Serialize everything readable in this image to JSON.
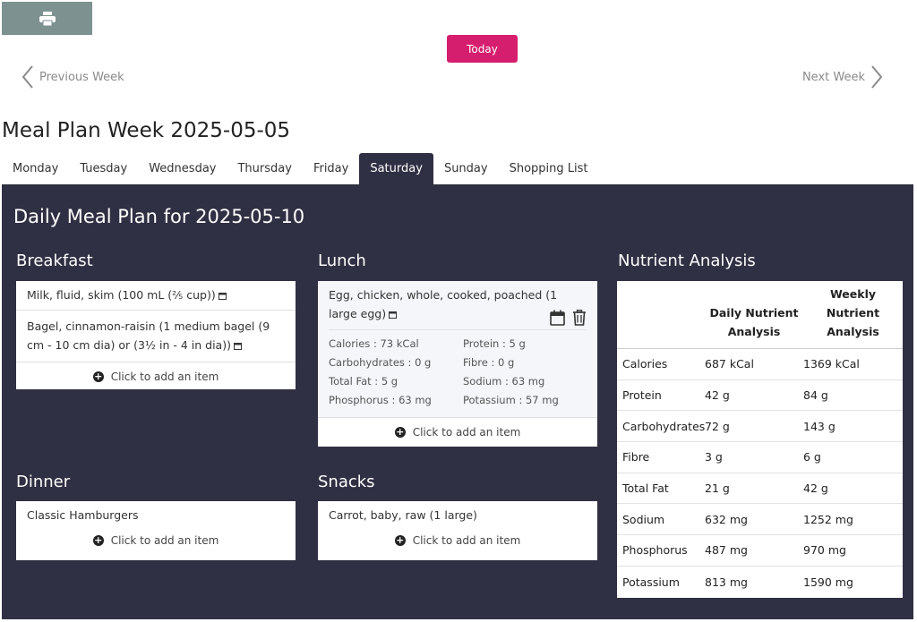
{
  "toolbar": {
    "today_label": "Today"
  },
  "nav": {
    "prev_label": "Previous Week",
    "next_label": "Next Week"
  },
  "page_title": "Meal Plan Week 2025-05-05",
  "tabs": [
    "Monday",
    "Tuesday",
    "Wednesday",
    "Thursday",
    "Friday",
    "Saturday",
    "Sunday",
    "Shopping List"
  ],
  "active_tab": "Saturday",
  "daily_title": "Daily Meal Plan for 2025-05-10",
  "add_item_label": "Click to add an item",
  "breakfast": {
    "title": "Breakfast",
    "items": [
      "Milk, fluid, skim (100 mL (⅖ cup))",
      "Bagel, cinnamon-raisin (1 medium bagel (9 cm - 10 cm dia) or (3½ in - 4 in dia))"
    ]
  },
  "lunch": {
    "title": "Lunch",
    "item": "Egg, chicken, whole, cooked, poached (1 large egg)",
    "nutrients": [
      "Calories : 73 kCal",
      "Protein : 5 g",
      "Carbohydrates : 0 g",
      "Fibre : 0 g",
      "Total Fat : 5 g",
      "Sodium : 63 mg",
      "Phosphorus : 63 mg",
      "Potassium : 57 mg"
    ]
  },
  "dinner": {
    "title": "Dinner",
    "items": [
      "Classic Hamburgers"
    ]
  },
  "snacks": {
    "title": "Snacks",
    "items": [
      "Carrot, baby, raw (1 large)"
    ]
  },
  "nutrient_analysis": {
    "title": "Nutrient Analysis",
    "col_daily": "Daily Nutrient Analysis",
    "col_weekly": "Weekly Nutrient Analysis",
    "rows": [
      [
        "Calories",
        "687 kCal",
        "1369 kCal"
      ],
      [
        "Protein",
        "42 g",
        "84 g"
      ],
      [
        "Carbohydrates",
        "72 g",
        "143 g"
      ],
      [
        "Fibre",
        "3 g",
        "6 g"
      ],
      [
        "Total Fat",
        "21 g",
        "42 g"
      ],
      [
        "Sodium",
        "632 mg",
        "1252 mg"
      ],
      [
        "Phosphorus",
        "487 mg",
        "970 mg"
      ],
      [
        "Potassium",
        "813 mg",
        "1590 mg"
      ]
    ]
  },
  "colors": {
    "accent": "#d61e6e",
    "panel": "#303044",
    "print_button": "#7d9191"
  }
}
